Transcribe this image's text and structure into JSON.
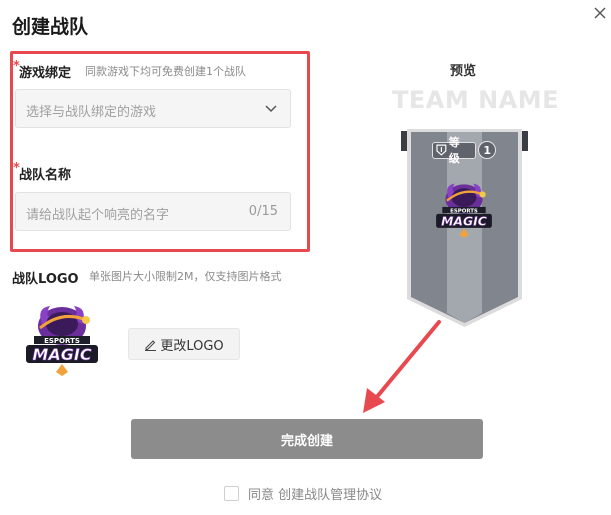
{
  "dialog": {
    "title": "创建战队"
  },
  "game_binding": {
    "label": "游戏绑定",
    "required_mark": "*",
    "hint": "同款游戏下均可免费创建1个战队",
    "placeholder": "选择与战队绑定的游戏"
  },
  "team_name": {
    "label": "战队名称",
    "required_mark": "*",
    "placeholder": "请给战队起个响亮的名字",
    "counter": "0/15"
  },
  "team_logo": {
    "label": "战队LOGO",
    "hint": "单张图片大小限制2M，仅支持图片格式",
    "change_button": "更改LOGO",
    "logo_text_top": "ESPORTS",
    "logo_text_main": "MAGIC"
  },
  "preview": {
    "label": "预览",
    "team_name_placeholder": "TEAM NAME",
    "level_label": "等级",
    "level_value": "1"
  },
  "actions": {
    "submit_label": "完成创建",
    "agree_label": "同意 创建战队管理协议"
  },
  "colors": {
    "highlight_border": "#e8494f",
    "submit_bg": "#8c8c8c",
    "banner_dark": "#80858e",
    "banner_light": "#a3a8ae"
  },
  "icons": {
    "close": "close-icon",
    "chevron": "chevron-down-icon",
    "edit": "edit-icon",
    "level": "level-shield-icon"
  }
}
